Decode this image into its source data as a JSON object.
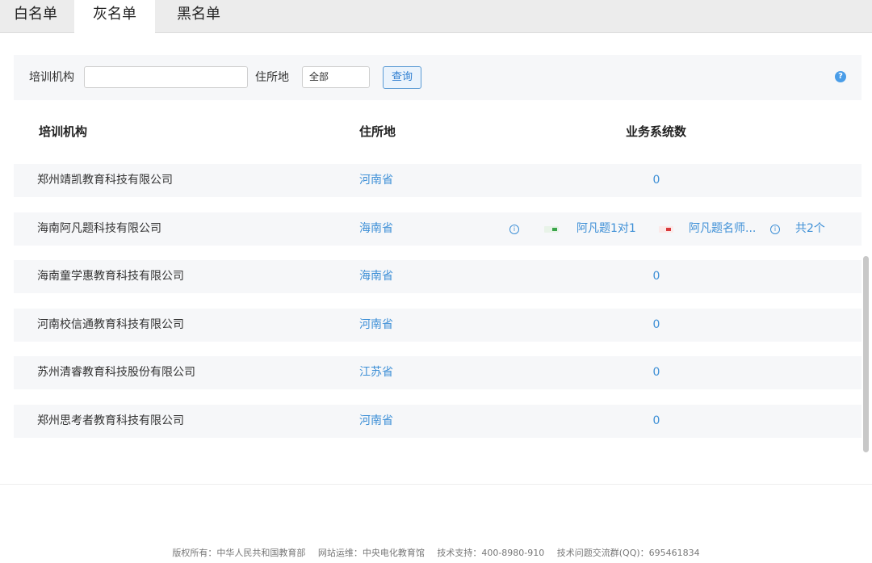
{
  "tabs": [
    {
      "label": "白名单",
      "active": false
    },
    {
      "label": "灰名单",
      "active": true
    },
    {
      "label": "黑名单",
      "active": false
    }
  ],
  "filter": {
    "org_label": "培训机构",
    "org_value": "",
    "location_label": "住所地",
    "location_value": "全部",
    "query_label": "查询",
    "help_icon": "?"
  },
  "table": {
    "headers": [
      "培训机构",
      "住所地",
      "业务系统数"
    ],
    "rows": [
      {
        "org": "郑州靖凯教育科技有限公司",
        "location": "河南省",
        "count": "0"
      },
      {
        "org": "海南阿凡题科技有限公司",
        "location": "海南省",
        "systems": [
          "阿凡题1对1",
          "阿凡题名师..."
        ],
        "total": "共2个"
      },
      {
        "org": "海南童学惠教育科技有限公司",
        "location": "海南省",
        "count": "0"
      },
      {
        "org": "河南校信通教育科技有限公司",
        "location": "河南省",
        "count": "0"
      },
      {
        "org": "苏州清睿教育科技股份有限公司",
        "location": "江苏省",
        "count": "0"
      },
      {
        "org": "郑州思考者教育科技有限公司",
        "location": "河南省",
        "count": "0"
      }
    ]
  },
  "footer": {
    "copyright": "版权所有：中华人民共和国教育部",
    "operator": "网站运维：中央电化教育馆",
    "support": "技术支持：400-8980-910",
    "qq": "技术问题交流群(QQ)：695461834"
  },
  "colors": {
    "link": "#3d8fd6",
    "row_bg": "#f6f7f9",
    "tab_bar": "#ececec"
  }
}
